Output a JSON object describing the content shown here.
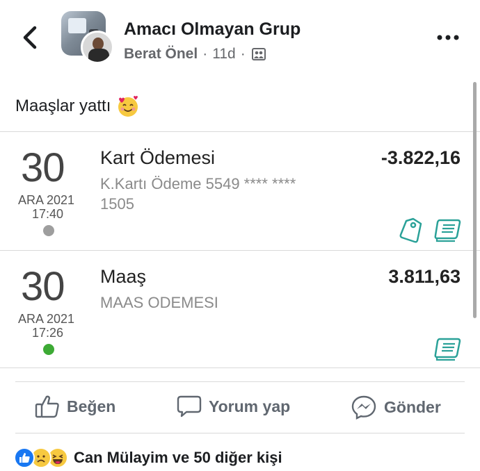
{
  "header": {
    "group_name": "Amacı Olmayan Grup",
    "author": "Berat Önel",
    "time": "11d",
    "separator": "·"
  },
  "post": {
    "text": "Maaşlar yattı"
  },
  "transactions": [
    {
      "day": "30",
      "month_year": "ARA 2021",
      "time": "17:40",
      "title": "Kart Ödemesi",
      "description": "K.Kartı Ödeme 5549 **** **** 1505",
      "amount": "-3.822,16",
      "status_color": "#9e9e9e"
    },
    {
      "day": "30",
      "month_year": "ARA 2021",
      "time": "17:26",
      "title": "Maaş",
      "description": "MAAS ODEMESI",
      "amount": "3.811,63",
      "status_color": "#3daa35"
    }
  ],
  "actions": {
    "like": "Beğen",
    "comment": "Yorum yap",
    "send": "Gönder"
  },
  "reactions": {
    "summary": "Can Mülayim ve 50 diğer kişi",
    "types": [
      "like",
      "sad",
      "haha"
    ]
  },
  "colors": {
    "accent_teal": "#2aa198",
    "like_blue": "#1877f2",
    "reaction_yellow": "#f7c940"
  }
}
